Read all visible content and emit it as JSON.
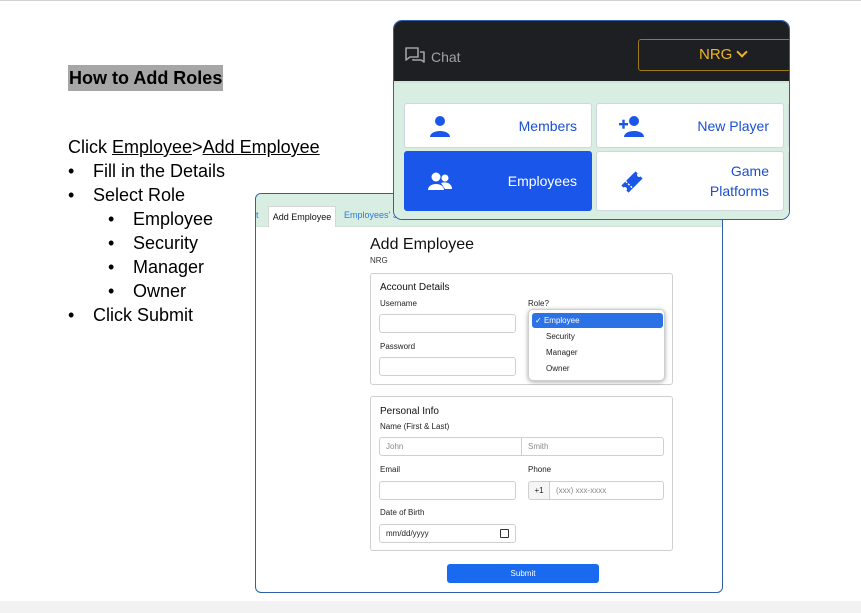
{
  "slide": {
    "heading": "How to Add Roles",
    "steps": {
      "click_prefix": "Click ",
      "employee_link": "Employee",
      "separator": ">",
      "add_employee_link": "Add Employee",
      "fill_details": "Fill in the Details",
      "select_role": "Select Role",
      "roles": [
        "Employee",
        "Security",
        "Manager",
        "Owner"
      ],
      "click_submit": "Click Submit"
    },
    "bullet": "•"
  },
  "app_nav": {
    "chat_label": "Chat",
    "org_button": "NRG",
    "tiles": [
      {
        "label": "Members",
        "icon": "person-icon",
        "active": false
      },
      {
        "label": "New Player",
        "icon": "person-add-icon",
        "active": false
      },
      {
        "label": "Employees",
        "icon": "people-icon",
        "active": true
      },
      {
        "label_line1": "Game",
        "label_line2": "Platforms",
        "icon": "ticket-icon",
        "active": false
      }
    ],
    "colors": {
      "topbar": "#1d1f22",
      "accent_gold": "#f0b429",
      "tile_blue": "#1a56ea",
      "tile_bg": "#d8eee2"
    }
  },
  "form": {
    "tabs": {
      "left_partial": "t",
      "active": "Add Employee",
      "other": "Employees' Sh"
    },
    "title": "Add Employee",
    "org": "NRG",
    "account": {
      "title": "Account Details",
      "username_label": "Username",
      "password_label": "Password",
      "role_label": "Role?",
      "role_options": [
        "Employee",
        "Security",
        "Manager",
        "Owner"
      ],
      "selected_role": "Employee",
      "check": "✓"
    },
    "personal": {
      "title": "Personal Info",
      "name_label": "Name (First & Last)",
      "first_placeholder": "John",
      "last_placeholder": "Smith",
      "email_label": "Email",
      "phone_label": "Phone",
      "phone_prefix": "+1",
      "phone_placeholder": "(xxx) xxx-xxxx",
      "dob_label": "Date of Birth",
      "dob_placeholder": "mm/dd/yyyy"
    },
    "submit_label": "Submit",
    "colors": {
      "submit": "#1a6af0",
      "selected_option": "#2b72e6"
    }
  }
}
